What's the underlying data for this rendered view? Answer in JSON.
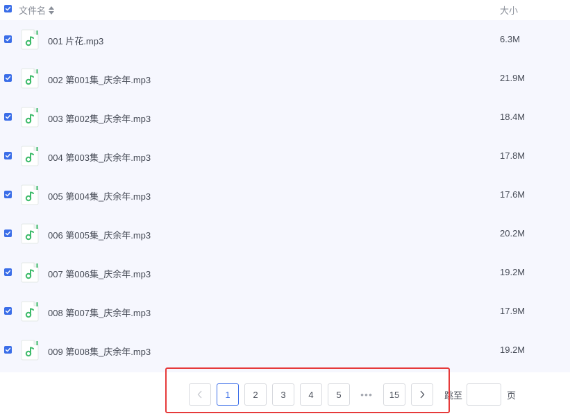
{
  "header": {
    "name_label": "文件名",
    "size_label": "大小"
  },
  "files": [
    {
      "name": "001 片花.mp3",
      "size": "6.3M"
    },
    {
      "name": "002 第001集_庆余年.mp3",
      "size": "21.9M"
    },
    {
      "name": "003 第002集_庆余年.mp3",
      "size": "18.4M"
    },
    {
      "name": "004 第003集_庆余年.mp3",
      "size": "17.8M"
    },
    {
      "name": "005 第004集_庆余年.mp3",
      "size": "17.6M"
    },
    {
      "name": "006 第005集_庆余年.mp3",
      "size": "20.2M"
    },
    {
      "name": "007 第006集_庆余年.mp3",
      "size": "19.2M"
    },
    {
      "name": "008 第007集_庆余年.mp3",
      "size": "17.9M"
    },
    {
      "name": "009 第008集_庆余年.mp3",
      "size": "19.2M"
    }
  ],
  "pagination": {
    "prev": "<",
    "pages": [
      "1",
      "2",
      "3",
      "4",
      "5"
    ],
    "ellipsis": "•••",
    "last": "15",
    "next": ">",
    "current": "1",
    "jump_label": "跳至",
    "jump_value": "",
    "page_unit": "页"
  },
  "colors": {
    "accent": "#3b6ee8",
    "file_icon": "#3dbb6a",
    "highlight": "#e63a3a",
    "list_bg": "#f6f7fe"
  }
}
